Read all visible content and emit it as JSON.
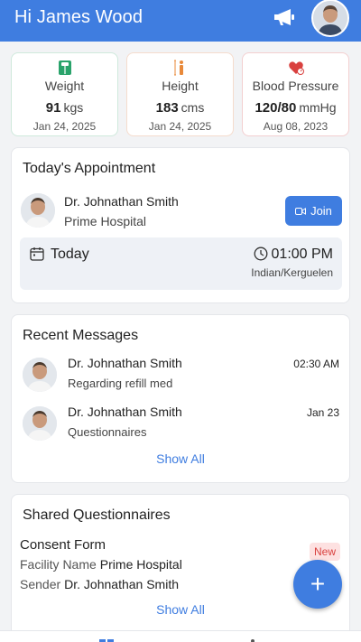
{
  "header": {
    "greeting": "Hi James Wood",
    "announce_icon": "megaphone-icon",
    "avatar": "user-avatar"
  },
  "vitals": [
    {
      "icon": "weight-scale-icon",
      "label": "Weight",
      "value": "91",
      "unit": "kgs",
      "date": "Jan 24, 2025",
      "color": "#2aa36b"
    },
    {
      "icon": "height-person-icon",
      "label": "Height",
      "value": "183",
      "unit": "cms",
      "date": "Jan 24, 2025",
      "color": "#e8893a"
    },
    {
      "icon": "heart-pulse-icon",
      "label": "Blood Pressure",
      "value": "120/80",
      "unit": "mmHg",
      "date": "Aug 08, 2023",
      "color": "#d9413f"
    }
  ],
  "appointment": {
    "title": "Today's Appointment",
    "doctor": "Dr. Johnathan Smith",
    "hospital": "Prime Hospital",
    "join_label": "Join",
    "day": "Today",
    "time": "01:00 PM",
    "timezone": "Indian/Kerguelen"
  },
  "messages": {
    "title": "Recent Messages",
    "items": [
      {
        "name": "Dr. Johnathan Smith",
        "subject": "Regarding refill med",
        "time": "02:30 AM"
      },
      {
        "name": "Dr. Johnathan Smith",
        "subject": "Questionnaires",
        "time": "Jan 23"
      }
    ],
    "show_all": "Show All"
  },
  "questionnaires": {
    "title": "Shared Questionnaires",
    "form_name": "Consent Form",
    "facility_label": "Facility Name",
    "facility_value": "Prime Hospital",
    "sender_label": "Sender",
    "sender_value": "Dr. Johnathan Smith",
    "badge": "New",
    "show_all": "Show All"
  },
  "fab_label": "+",
  "colors": {
    "primary": "#3f7de0",
    "badge_bg": "#fde1e1",
    "badge_text": "#d9413f"
  }
}
